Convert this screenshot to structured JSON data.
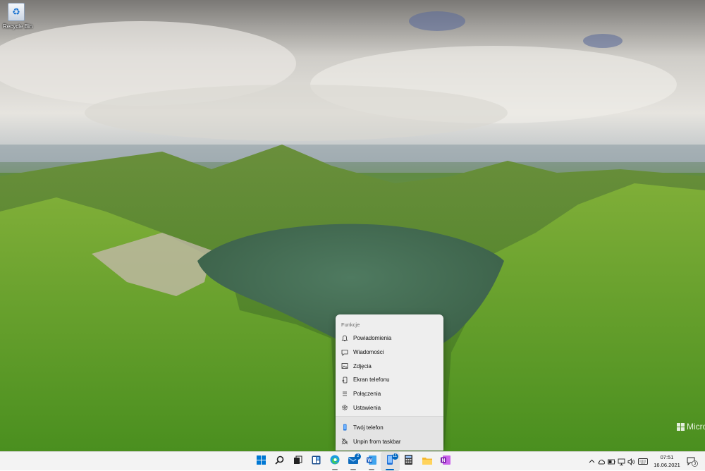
{
  "desktop": {
    "recycle_bin_label": "Recycle Bin",
    "watermark_text": "Microsoft"
  },
  "jumplist": {
    "header": "Funkcje",
    "items": [
      {
        "label": "Powiadomienia",
        "icon": "bell-icon"
      },
      {
        "label": "Wiadomości",
        "icon": "message-icon"
      },
      {
        "label": "Zdjęcia",
        "icon": "photo-icon"
      },
      {
        "label": "Ekran telefonu",
        "icon": "phone-screen-icon"
      },
      {
        "label": "Połączenia",
        "icon": "dialpad-icon"
      },
      {
        "label": "Ustawienia",
        "icon": "gear-icon"
      }
    ],
    "footer_items": [
      {
        "label": "Twój telefon",
        "icon": "phone-icon"
      },
      {
        "label": "Unpin from taskbar",
        "icon": "unpin-icon"
      }
    ]
  },
  "taskbar": {
    "apps": [
      {
        "name": "start",
        "icon": "windows-icon"
      },
      {
        "name": "search",
        "icon": "search-icon"
      },
      {
        "name": "task-view",
        "icon": "task-view-icon"
      },
      {
        "name": "widgets",
        "icon": "widgets-icon"
      },
      {
        "name": "edge",
        "icon": "edge-icon"
      },
      {
        "name": "mail",
        "icon": "mail-icon",
        "badge": "2"
      },
      {
        "name": "word",
        "icon": "word-icon"
      },
      {
        "name": "your-phone",
        "icon": "phone-app-icon",
        "badge": "11",
        "active": true
      },
      {
        "name": "calculator",
        "icon": "calculator-icon"
      },
      {
        "name": "file-explorer",
        "icon": "folder-icon"
      },
      {
        "name": "onenote",
        "icon": "onenote-icon"
      }
    ],
    "time": "07:51",
    "date": "16.06.2021",
    "notification_count": "3"
  },
  "colors": {
    "accent": "#0067c0",
    "taskbar_bg": "#f3f3f3",
    "menu_bg": "#eeeeee"
  }
}
